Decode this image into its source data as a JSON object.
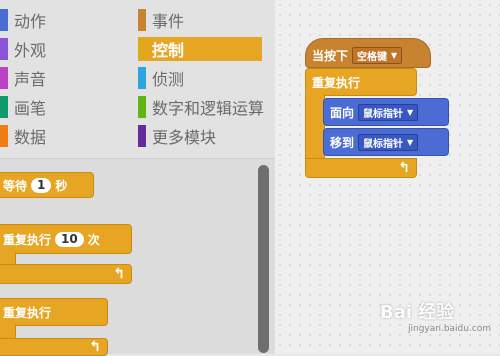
{
  "categories": {
    "left": [
      {
        "label": "动作",
        "color": "#4a6cd4"
      },
      {
        "label": "外观",
        "color": "#8a55d7"
      },
      {
        "label": "声音",
        "color": "#bb42c3"
      },
      {
        "label": "画笔",
        "color": "#0e9a6c"
      },
      {
        "label": "数据",
        "color": "#ee7d16"
      }
    ],
    "right": [
      {
        "label": "事件",
        "color": "#c88330"
      },
      {
        "label": "控制",
        "color": "#e1a91a",
        "selected": true
      },
      {
        "label": "侦测",
        "color": "#2ca5e2"
      },
      {
        "label": "数字和逻辑运算",
        "color": "#5cb712"
      },
      {
        "label": "更多模块",
        "color": "#632d99"
      }
    ]
  },
  "palette": {
    "wait": {
      "label": "等待",
      "value": "1",
      "unit": "秒"
    },
    "repeat": {
      "label": "重复执行",
      "value": "10",
      "unit": "次"
    },
    "forever": {
      "label": "重复执行"
    }
  },
  "script": {
    "hat": {
      "label": "当按下",
      "key": "空格键"
    },
    "forever": {
      "label": "重复执行"
    },
    "point": {
      "label": "面向",
      "target": "鼠标指针"
    },
    "goto": {
      "label": "移到",
      "target": "鼠标指针"
    }
  },
  "watermark": {
    "text": "Bai 经验",
    "sub": "jingyan.baidu.com"
  }
}
